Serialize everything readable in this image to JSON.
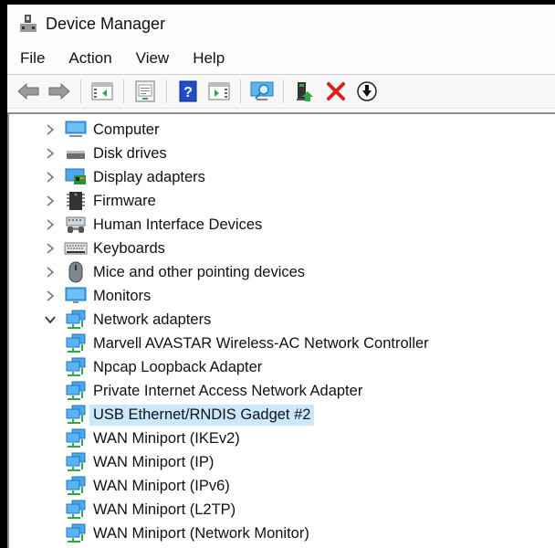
{
  "window": {
    "title": "Device Manager",
    "icon": "device-manager-icon"
  },
  "menu": [
    "File",
    "Action",
    "View",
    "Help"
  ],
  "toolbar": [
    {
      "name": "back-button",
      "icon": "arrow-left-icon"
    },
    {
      "name": "forward-button",
      "icon": "arrow-right-icon"
    },
    {
      "name": "show-hide-console-tree-button",
      "icon": "console-tree-icon"
    },
    {
      "name": "properties-button",
      "icon": "properties-icon"
    },
    {
      "name": "help-button",
      "icon": "help-icon"
    },
    {
      "name": "show-action-pane-button",
      "icon": "action-pane-icon"
    },
    {
      "name": "scan-hardware-button",
      "icon": "scan-monitor-icon"
    },
    {
      "name": "update-driver-button",
      "icon": "update-driver-icon"
    },
    {
      "name": "uninstall-button",
      "icon": "red-x-icon"
    },
    {
      "name": "disable-button",
      "icon": "down-arrow-circle-icon"
    }
  ],
  "tree": {
    "categories": [
      {
        "label": "Computer",
        "icon": "computer-icon",
        "expanded": false
      },
      {
        "label": "Disk drives",
        "icon": "disk-drive-icon",
        "expanded": false
      },
      {
        "label": "Display adapters",
        "icon": "display-adapter-icon",
        "expanded": false
      },
      {
        "label": "Firmware",
        "icon": "firmware-chip-icon",
        "expanded": false
      },
      {
        "label": "Human Interface Devices",
        "icon": "hid-icon",
        "expanded": false
      },
      {
        "label": "Keyboards",
        "icon": "keyboard-icon",
        "expanded": false
      },
      {
        "label": "Mice and other pointing devices",
        "icon": "mouse-icon",
        "expanded": false
      },
      {
        "label": "Monitors",
        "icon": "monitor-icon",
        "expanded": false
      },
      {
        "label": "Network adapters",
        "icon": "network-adapter-icon",
        "expanded": true
      }
    ],
    "network_adapters": [
      {
        "label": "Marvell AVASTAR Wireless-AC Network Controller",
        "selected": false
      },
      {
        "label": "Npcap Loopback Adapter",
        "selected": false
      },
      {
        "label": "Private Internet Access Network Adapter",
        "selected": false
      },
      {
        "label": "USB Ethernet/RNDIS Gadget #2",
        "selected": true
      },
      {
        "label": "WAN Miniport (IKEv2)",
        "selected": false
      },
      {
        "label": "WAN Miniport (IP)",
        "selected": false
      },
      {
        "label": "WAN Miniport (IPv6)",
        "selected": false
      },
      {
        "label": "WAN Miniport (L2TP)",
        "selected": false
      },
      {
        "label": "WAN Miniport (Network Monitor)",
        "selected": false
      }
    ]
  },
  "colors": {
    "selection": "#cce8ff",
    "accent_blue": "#3c9be6",
    "network_green": "#2fa84a",
    "delete_red": "#e0201b"
  }
}
